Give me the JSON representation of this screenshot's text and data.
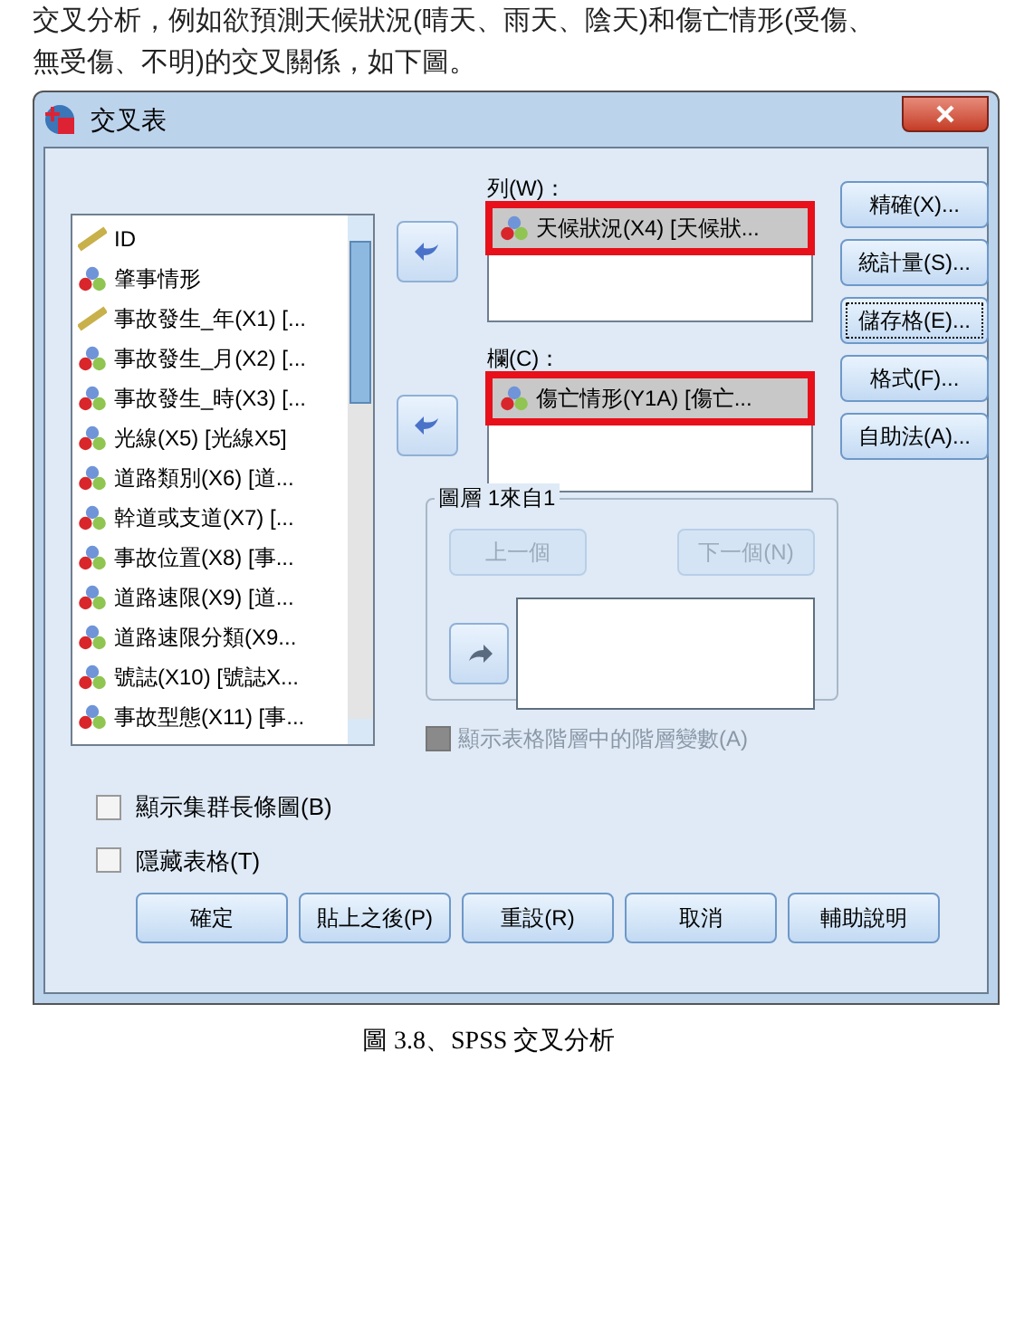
{
  "document": {
    "paragraph_lines": [
      "交叉分析，例如欲預測天候狀況(晴天、雨天、陰天)和傷亡情形(受傷、",
      "無受傷、不明)的交叉關係，如下圖。"
    ],
    "caption": "圖 3.8、SPSS 交叉分析"
  },
  "dialog": {
    "title": "交叉表",
    "variables": [
      {
        "name": "ID",
        "kind": "scale"
      },
      {
        "name": "肇事情形",
        "kind": "nominal"
      },
      {
        "name": "事故發生_年(X1) [...",
        "kind": "scale"
      },
      {
        "name": "事故發生_月(X2) [...",
        "kind": "nominal"
      },
      {
        "name": "事故發生_時(X3) [...",
        "kind": "nominal"
      },
      {
        "name": "光線(X5) [光線X5]",
        "kind": "nominal"
      },
      {
        "name": "道路類別(X6) [道...",
        "kind": "nominal"
      },
      {
        "name": "幹道或支道(X7) [...",
        "kind": "nominal"
      },
      {
        "name": "事故位置(X8) [事...",
        "kind": "nominal"
      },
      {
        "name": "道路速限(X9) [道...",
        "kind": "nominal"
      },
      {
        "name": "道路速限分類(X9...",
        "kind": "nominal"
      },
      {
        "name": "號誌(X10) [號誌X...",
        "kind": "nominal"
      },
      {
        "name": "事故型態(X11) [事...",
        "kind": "nominal"
      }
    ],
    "row_label": "列(W)：",
    "row_items": [
      {
        "name": "天候狀況(X4) [天候狀...",
        "highlighted": true
      }
    ],
    "column_label": "欄(C)：",
    "column_items": [
      {
        "name": "傷亡情形(Y1A) [傷亡...",
        "highlighted": true
      }
    ],
    "layer": {
      "title": "圖層 1來自1",
      "previous": "上一個",
      "next": "下一個(N)",
      "disabled": true
    },
    "layer_checkbox": {
      "label": "顯示表格階層中的階層變數(A)",
      "checked": false,
      "disabled": true
    },
    "side_buttons": [
      {
        "label": "精確(X)...",
        "focused": false
      },
      {
        "label": "統計量(S)...",
        "focused": false
      },
      {
        "label": "儲存格(E)...",
        "focused": true
      },
      {
        "label": "格式(F)...",
        "focused": false
      },
      {
        "label": "自助法(A)...",
        "focused": false
      }
    ],
    "options": [
      {
        "label": "顯示集群長條圖(B)",
        "checked": false
      },
      {
        "label": "隱藏表格(T)",
        "checked": false
      }
    ],
    "buttons": [
      "確定",
      "貼上之後(P)",
      "重設(R)",
      "取消",
      "輔助說明"
    ]
  }
}
